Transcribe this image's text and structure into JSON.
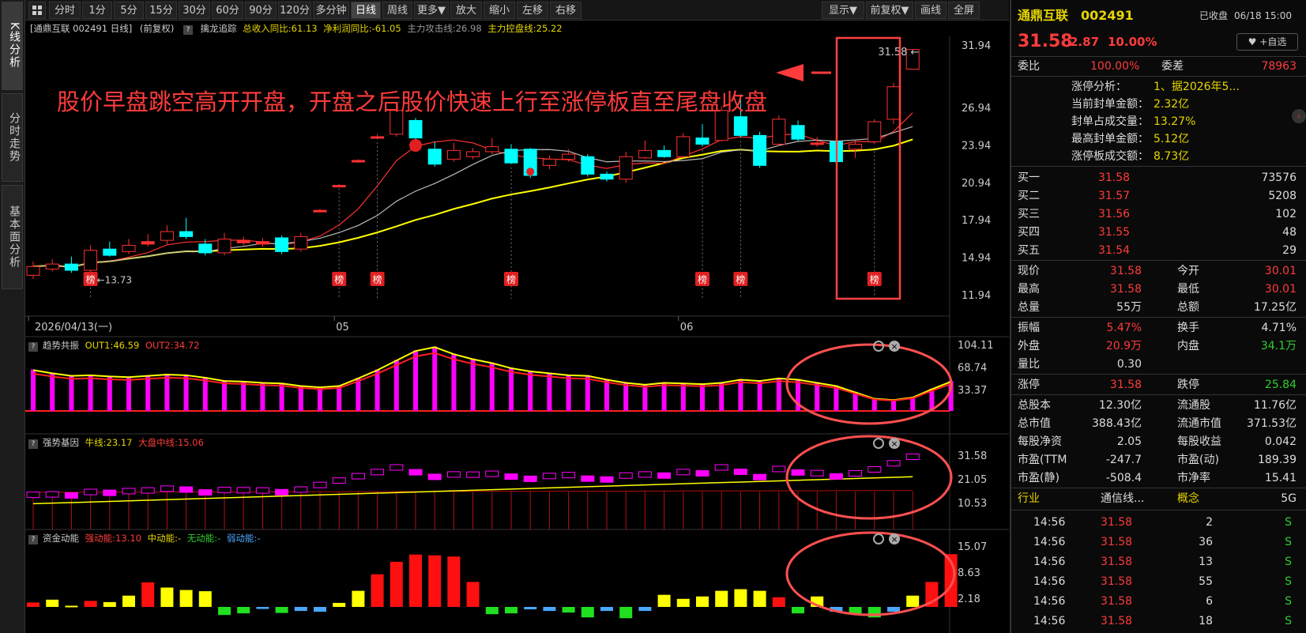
{
  "left_tabs": [
    "K线分析",
    "分时走势",
    "基本面分析"
  ],
  "toolbar": {
    "left": [
      "分时",
      "1分",
      "5分",
      "15分",
      "30分",
      "60分",
      "90分",
      "120分",
      "多分钟",
      "日线",
      "周线",
      "更多▼",
      "放大",
      "缩小",
      "左移",
      "右移"
    ],
    "right": [
      "显示▼",
      "前复权▼",
      "画线",
      "全屏"
    ],
    "active": "日线"
  },
  "info_bar": {
    "stock": "[通鼎互联 002491 日线]",
    "fq": "(前复权)",
    "q": "?",
    "indicator": "擒龙追踪",
    "rev": "总收入同比:61.13",
    "profit": "净利润同比:-61.05",
    "attack": "主力攻击线:26.98",
    "control": "主力控盘线:25.22"
  },
  "main_chart": {
    "y_labels": [
      "31.94",
      "26.94",
      "23.94",
      "20.94",
      "17.94",
      "14.94",
      "11.94"
    ],
    "date_labels": [
      "2026/04/13(一)",
      "05",
      "06"
    ],
    "low_label": "13.73",
    "high_label": "31.58",
    "bang": "榜",
    "annotation": "股价早盘跳空高开开盘，开盘之后股价快速上行至涨停板直至尾盘收盘",
    "candles": [
      {
        "o": 13.5,
        "c": 14.2,
        "h": 14.6,
        "l": 13.2
      },
      {
        "o": 14.0,
        "c": 14.4,
        "h": 14.8,
        "l": 13.8
      },
      {
        "o": 14.4,
        "c": 13.9,
        "h": 15.0,
        "l": 13.7
      },
      {
        "o": 13.9,
        "c": 15.5,
        "h": 15.9,
        "l": 13.73
      },
      {
        "o": 15.6,
        "c": 15.1,
        "h": 16.2,
        "l": 15.0
      },
      {
        "o": 15.4,
        "c": 15.9,
        "h": 16.4,
        "l": 15.2
      },
      {
        "o": 16.0,
        "c": 16.2,
        "h": 16.8,
        "l": 15.8
      },
      {
        "o": 16.3,
        "c": 17.0,
        "h": 17.5,
        "l": 16.0
      },
      {
        "o": 17.0,
        "c": 16.6,
        "h": 18.1,
        "l": 16.4
      },
      {
        "o": 16.0,
        "c": 15.3,
        "h": 16.4,
        "l": 15.1
      },
      {
        "o": 15.3,
        "c": 16.4,
        "h": 16.9,
        "l": 15.1
      },
      {
        "o": 16.1,
        "c": 16.3,
        "h": 16.6,
        "l": 15.9
      },
      {
        "o": 16.0,
        "c": 16.2,
        "h": 16.5,
        "l": 15.8
      },
      {
        "o": 16.5,
        "c": 15.4,
        "h": 16.7,
        "l": 15.2
      },
      {
        "o": 15.6,
        "c": 16.6,
        "h": 16.9,
        "l": 15.4
      },
      {
        "o": 18.7,
        "c": 18.7,
        "h": 18.8,
        "l": 18.6
      },
      {
        "o": 20.7,
        "c": 20.7,
        "h": 20.8,
        "l": 20.7
      },
      {
        "o": 22.7,
        "c": 22.7,
        "h": 22.8,
        "l": 22.5
      },
      {
        "o": 24.6,
        "c": 24.6,
        "h": 24.8,
        "l": 24.4
      },
      {
        "o": 24.8,
        "c": 26.7,
        "h": 27.3,
        "l": 24.6
      },
      {
        "o": 25.9,
        "c": 24.5,
        "h": 26.1,
        "l": 24.3
      },
      {
        "o": 23.6,
        "c": 22.4,
        "h": 24.2,
        "l": 22.2
      },
      {
        "o": 22.8,
        "c": 23.5,
        "h": 24.1,
        "l": 22.6
      },
      {
        "o": 23.0,
        "c": 23.4,
        "h": 23.7,
        "l": 22.8
      },
      {
        "o": 23.4,
        "c": 23.8,
        "h": 24.5,
        "l": 23.2
      },
      {
        "o": 23.6,
        "c": 22.5,
        "h": 24.0,
        "l": 22.4
      },
      {
        "o": 23.6,
        "c": 21.5,
        "h": 23.7,
        "l": 21.3
      },
      {
        "o": 22.3,
        "c": 22.8,
        "h": 23.1,
        "l": 22.0
      },
      {
        "o": 22.8,
        "c": 23.2,
        "h": 23.6,
        "l": 22.6
      },
      {
        "o": 23.0,
        "c": 21.6,
        "h": 23.2,
        "l": 21.4
      },
      {
        "o": 21.6,
        "c": 21.2,
        "h": 21.8,
        "l": 21.0
      },
      {
        "o": 21.2,
        "c": 23.0,
        "h": 23.4,
        "l": 20.9
      },
      {
        "o": 22.9,
        "c": 23.5,
        "h": 24.3,
        "l": 22.8
      },
      {
        "o": 23.5,
        "c": 23.0,
        "h": 23.9,
        "l": 22.9
      },
      {
        "o": 23.0,
        "c": 24.6,
        "h": 24.9,
        "l": 22.9
      },
      {
        "o": 24.5,
        "c": 24.0,
        "h": 25.6,
        "l": 23.8
      },
      {
        "o": 24.3,
        "c": 26.7,
        "h": 27.0,
        "l": 24.2
      },
      {
        "o": 26.2,
        "c": 24.7,
        "h": 28.0,
        "l": 24.5
      },
      {
        "o": 24.7,
        "c": 22.3,
        "h": 25.0,
        "l": 22.1
      },
      {
        "o": 24.0,
        "c": 26.0,
        "h": 26.3,
        "l": 23.9
      },
      {
        "o": 25.5,
        "c": 24.4,
        "h": 25.9,
        "l": 24.2
      },
      {
        "o": 24.0,
        "c": 24.1,
        "h": 24.6,
        "l": 23.8
      },
      {
        "o": 24.2,
        "c": 22.6,
        "h": 24.5,
        "l": 22.4
      },
      {
        "o": 23.6,
        "c": 24.0,
        "h": 24.3,
        "l": 22.9
      },
      {
        "o": 24.2,
        "c": 25.8,
        "h": 26.0,
        "l": 24.0
      },
      {
        "o": 26.0,
        "c": 28.6,
        "h": 28.9,
        "l": 25.6
      },
      {
        "o": 30.01,
        "c": 31.58,
        "h": 31.58,
        "l": 30.01
      }
    ],
    "bang_indices": [
      3,
      16,
      18,
      25,
      35,
      37,
      44
    ]
  },
  "panel1": {
    "name": "趋势共振",
    "out1": "OUT1:46.59",
    "out2": "OUT2:34.72",
    "y_labels": [
      "104.11",
      "68.74",
      "33.37"
    ],
    "values": [
      65,
      60,
      56,
      57,
      55,
      54,
      56,
      58,
      57,
      53,
      48,
      47,
      45,
      44,
      40,
      38,
      40,
      52,
      65,
      80,
      95,
      101,
      90,
      82,
      76,
      68,
      63,
      60,
      57,
      56,
      50,
      45,
      42,
      45,
      44,
      43,
      45,
      50,
      48,
      52,
      50,
      45,
      40,
      30,
      20,
      18,
      22,
      35,
      47
    ]
  },
  "panel2": {
    "name": "强势基因",
    "bull": "牛线:23.17",
    "mid": "大盘中线:15.06",
    "y_labels": [
      "31.58",
      "21.05",
      "10.53"
    ]
  },
  "panel3": {
    "name": "资金动能",
    "strong": "强动能:13.10",
    "mid": "中动能:-",
    "none": "无动能:-",
    "weak": "弱动能:-",
    "y_labels": [
      "15.07",
      "8.63",
      "2.18"
    ],
    "values": [
      1.1,
      1.8,
      0.3,
      1.5,
      1.2,
      2.8,
      6.1,
      4.8,
      4.2,
      3.9,
      -2.0,
      -1.6,
      -0.5,
      -1.5,
      -1.0,
      -1.2,
      1.0,
      4.0,
      8.1,
      11.2,
      13.0,
      12.8,
      12.5,
      6.2,
      -1.8,
      -1.6,
      -0.6,
      -1.0,
      -1.4,
      -2.6,
      -1.0,
      -2.8,
      -1.0,
      3.0,
      2.0,
      2.6,
      4.0,
      4.4,
      4.0,
      2.4,
      -1.6,
      2.6,
      -1.2,
      -1.6,
      -2.6,
      -1.2,
      2.8,
      6.2,
      13.1
    ]
  },
  "right": {
    "name": "通鼎互联",
    "code": "002491",
    "status": "已收盘",
    "datetime": "06/18 15:00",
    "price": "31.58",
    "change": "2.87",
    "pct": "10.00%",
    "fav": "+自选",
    "webi_l": "委比",
    "webi": "100.00%",
    "wecha_l": "委差",
    "wecha": "78963",
    "limit_rows": [
      {
        "k": "涨停分析：",
        "v": "1、据2026年5..."
      },
      {
        "k": "当前封单金额：",
        "v": "2.32亿"
      },
      {
        "k": "封单占成交量：",
        "v": "13.27%"
      },
      {
        "k": "最高封单金额：",
        "v": "5.12亿"
      },
      {
        "k": "涨停板成交额：",
        "v": "8.73亿"
      }
    ],
    "book": [
      {
        "k": "买一",
        "p": "31.58",
        "v": "73576"
      },
      {
        "k": "买二",
        "p": "31.57",
        "v": "5208"
      },
      {
        "k": "买三",
        "p": "31.56",
        "v": "102"
      },
      {
        "k": "买四",
        "p": "31.55",
        "v": "48"
      },
      {
        "k": "买五",
        "p": "31.54",
        "v": "29"
      }
    ],
    "stats1": [
      {
        "k1": "现价",
        "v1": "31.58",
        "c1": "red",
        "k2": "今开",
        "v2": "30.01",
        "c2": "red"
      },
      {
        "k1": "最高",
        "v1": "31.58",
        "c1": "red",
        "k2": "最低",
        "v2": "30.01",
        "c2": "red"
      },
      {
        "k1": "总量",
        "v1": "55万",
        "c1": "white",
        "k2": "总额",
        "v2": "17.25亿",
        "c2": "white"
      }
    ],
    "stats2": [
      {
        "k1": "振幅",
        "v1": "5.47%",
        "c1": "red",
        "k2": "换手",
        "v2": "4.71%",
        "c2": "white"
      },
      {
        "k1": "外盘",
        "v1": "20.9万",
        "c1": "red",
        "k2": "内盘",
        "v2": "34.1万",
        "c2": "green"
      },
      {
        "k1": "量比",
        "v1": "0.30",
        "c1": "white",
        "k2": "",
        "v2": "",
        "c2": "white"
      }
    ],
    "stats3": [
      {
        "k1": "涨停",
        "v1": "31.58",
        "c1": "red",
        "k2": "跌停",
        "v2": "25.84",
        "c2": "green"
      }
    ],
    "stats4": [
      {
        "k1": "总股本",
        "v1": "12.30亿",
        "c1": "white",
        "k2": "流通股",
        "v2": "11.76亿",
        "c2": "white"
      },
      {
        "k1": "总市值",
        "v1": "388.43亿",
        "c1": "white",
        "k2": "流通市值",
        "v2": "371.53亿",
        "c2": "white"
      },
      {
        "k1": "每股净资",
        "v1": "2.05",
        "c1": "white",
        "k2": "每股收益",
        "v2": "0.042",
        "c2": "white"
      },
      {
        "k1": "市盈(TTM",
        "v1": "-247.7",
        "c1": "white",
        "k2": "市盈(动)",
        "v2": "189.39",
        "c2": "white"
      },
      {
        "k1": "市盈(静)",
        "v1": "-508.4",
        "c1": "white",
        "k2": "市净率",
        "v2": "15.41",
        "c2": "white"
      }
    ],
    "industry_l": "行业",
    "industry": "通信线...",
    "concept_l": "概念",
    "concept": "5G",
    "ticks": [
      {
        "t": "14:56",
        "p": "31.58",
        "v": "2",
        "s": "S"
      },
      {
        "t": "14:56",
        "p": "31.58",
        "v": "36",
        "s": "S"
      },
      {
        "t": "14:56",
        "p": "31.58",
        "v": "13",
        "s": "S"
      },
      {
        "t": "14:56",
        "p": "31.58",
        "v": "55",
        "s": "S"
      },
      {
        "t": "14:56",
        "p": "31.58",
        "v": "6",
        "s": "S"
      },
      {
        "t": "14:56",
        "p": "31.58",
        "v": "18",
        "s": "S"
      }
    ]
  }
}
